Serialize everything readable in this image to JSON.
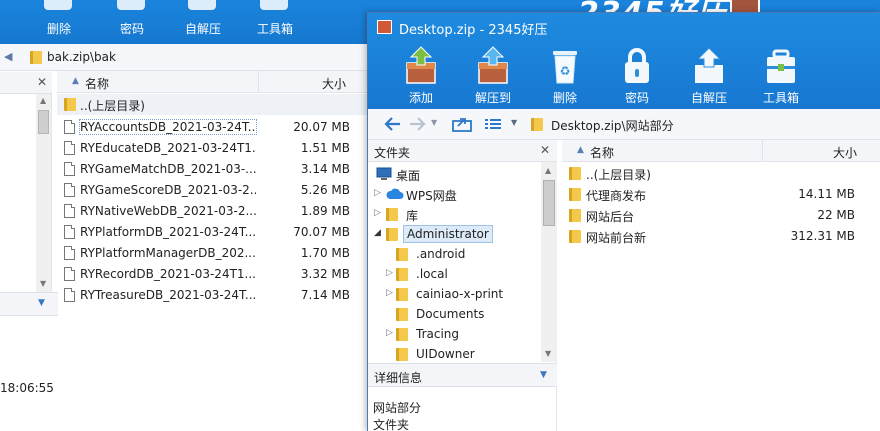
{
  "background_window": {
    "toolbar": [
      {
        "label": "删除",
        "icon": "delete-icon"
      },
      {
        "label": "密码",
        "icon": "lock-icon"
      },
      {
        "label": "自解压",
        "icon": "self-extract-icon"
      },
      {
        "label": "工具箱",
        "icon": "toolbox-icon"
      }
    ],
    "brand": "2345好压",
    "path": "bak.zip\\bak",
    "columns": {
      "name": "名称",
      "size": "大小"
    },
    "parent_row": "..(上层目录)",
    "files": [
      {
        "name": "RYAccountsDB_2021-03-24T...",
        "size": "20.07 MB"
      },
      {
        "name": "RYEducateDB_2021-03-24T1...",
        "size": "1.51 MB"
      },
      {
        "name": "RYGameMatchDB_2021-03-...",
        "size": "3.14 MB"
      },
      {
        "name": "RYGameScoreDB_2021-03-2...",
        "size": "5.26 MB"
      },
      {
        "name": "RYNativeWebDB_2021-03-2...",
        "size": "1.89 MB"
      },
      {
        "name": "RYPlatformDB_2021-03-24T...",
        "size": "70.07 MB"
      },
      {
        "name": "RYPlatformManagerDB_202...",
        "size": "1.70 MB"
      },
      {
        "name": "RYRecordDB_2021-03-24T1...",
        "size": "3.32 MB"
      },
      {
        "name": "RYTreasureDB_2021-03-24T...",
        "size": "7.14 MB"
      }
    ],
    "timestamp": "18:06:55"
  },
  "front_window": {
    "title": "Desktop.zip - 2345好压",
    "toolbar": [
      {
        "label": "添加",
        "icon": "add-archive-icon"
      },
      {
        "label": "解压到",
        "icon": "extract-to-icon"
      },
      {
        "label": "删除",
        "icon": "recycle-bin-icon"
      },
      {
        "label": "密码",
        "icon": "lock-icon"
      },
      {
        "label": "自解压",
        "icon": "self-extract-icon"
      },
      {
        "label": "工具箱",
        "icon": "toolbox-icon"
      }
    ],
    "path": "Desktop.zip\\网站部分",
    "tree_header": "文件夹",
    "tree": [
      {
        "label": "桌面",
        "icon": "desktop-icon",
        "level": 0,
        "expandable": false
      },
      {
        "label": "WPS网盘",
        "icon": "cloud-icon",
        "level": 0,
        "expandable": true
      },
      {
        "label": "库",
        "icon": "library-icon",
        "level": 0,
        "expandable": true
      },
      {
        "label": "Administrator",
        "icon": "user-folder-icon",
        "level": 0,
        "expandable": true,
        "selected": true
      },
      {
        "label": ".android",
        "icon": "folder-icon",
        "level": 1,
        "expandable": false
      },
      {
        "label": ".local",
        "icon": "folder-icon",
        "level": 1,
        "expandable": true
      },
      {
        "label": "cainiao-x-print",
        "icon": "folder-icon",
        "level": 1,
        "expandable": true
      },
      {
        "label": "Documents",
        "icon": "folder-icon",
        "level": 1,
        "expandable": false
      },
      {
        "label": "Tracing",
        "icon": "folder-icon",
        "level": 1,
        "expandable": true
      },
      {
        "label": "UIDowner",
        "icon": "folder-icon",
        "level": 1,
        "expandable": false
      }
    ],
    "details_header": "详细信息",
    "details": {
      "name": "网站部分",
      "type": "文件夹"
    },
    "columns": {
      "name": "名称",
      "size": "大小"
    },
    "parent_row": "..(上层目录)",
    "files": [
      {
        "name": "代理商发布",
        "size": "14.11 MB"
      },
      {
        "name": "网站后台",
        "size": "22 MB"
      },
      {
        "name": "网站前台新",
        "size": "312.31 MB"
      }
    ]
  }
}
